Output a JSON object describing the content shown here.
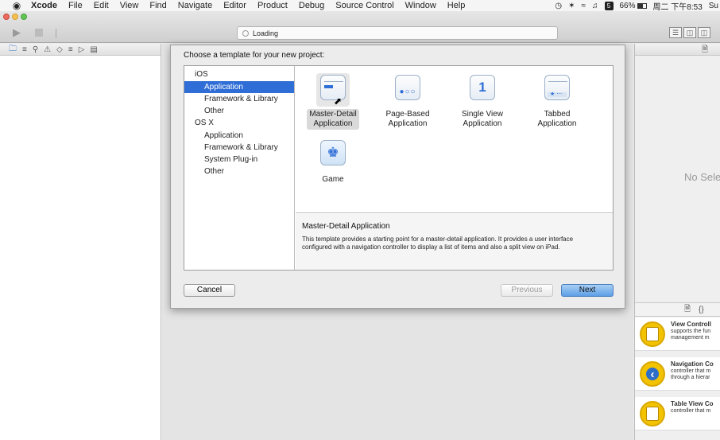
{
  "menubar": {
    "apple": "",
    "items": [
      "Xcode",
      "File",
      "Edit",
      "View",
      "Find",
      "Navigate",
      "Editor",
      "Product",
      "Debug",
      "Source Control",
      "Window",
      "Help"
    ],
    "battery_pct": "66%",
    "tile": "5",
    "clock": "周二 下午8:53",
    "user": "Su"
  },
  "toolbar": {
    "activity_text": "Loading"
  },
  "sheet": {
    "title": "Choose a template for your new project:",
    "categories": [
      {
        "label": "iOS",
        "type": "group"
      },
      {
        "label": "Application",
        "type": "sub",
        "selected": true
      },
      {
        "label": "Framework & Library",
        "type": "sub"
      },
      {
        "label": "Other",
        "type": "sub"
      },
      {
        "label": "OS X",
        "type": "group"
      },
      {
        "label": "Application",
        "type": "sub"
      },
      {
        "label": "Framework & Library",
        "type": "sub"
      },
      {
        "label": "System Plug-in",
        "type": "sub"
      },
      {
        "label": "Other",
        "type": "sub"
      }
    ],
    "templates": [
      {
        "line1": "Master-Detail",
        "line2": "Application",
        "icon": "master-detail-icon",
        "selected": true
      },
      {
        "line1": "Page-Based",
        "line2": "Application",
        "icon": "page-based-icon"
      },
      {
        "line1": "Single View",
        "line2": "Application",
        "icon": "single-view-icon",
        "glyph": "1"
      },
      {
        "line1": "Tabbed",
        "line2": "Application",
        "icon": "tabbed-icon"
      },
      {
        "line1": "Game",
        "line2": "",
        "icon": "game-icon"
      }
    ],
    "description_title": "Master-Detail Application",
    "description_body": "This template provides a starting point for a master-detail application. It provides a user interface configured with a navigation controller to display a list of items and also a split view on iPad.",
    "buttons": {
      "cancel": "Cancel",
      "previous": "Previous",
      "next": "Next"
    }
  },
  "utilities": {
    "no_selection": "No Sele",
    "library": [
      {
        "title": "View Controll",
        "line1": "supports the fun",
        "line2": "management m",
        "icon": "view-controller-icon"
      },
      {
        "title": "Navigation Co",
        "line1": "controller that m",
        "line2": "through a hierar",
        "icon": "navigation-controller-icon"
      },
      {
        "title": "Table View Co",
        "line1": "controller that m",
        "line2": "",
        "icon": "table-view-controller-icon"
      }
    ]
  }
}
